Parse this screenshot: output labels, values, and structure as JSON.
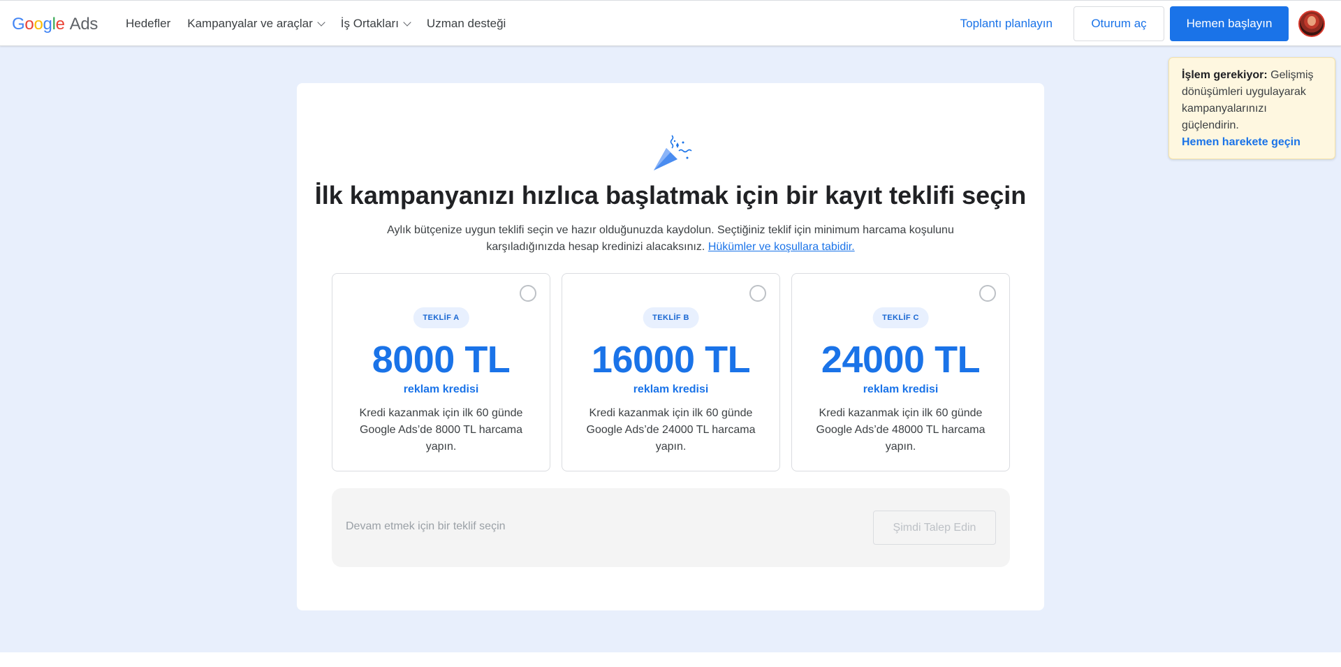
{
  "header": {
    "logo_google": [
      "G",
      "o",
      "o",
      "g",
      "l",
      "e"
    ],
    "logo_ads": "Ads",
    "nav": [
      {
        "label": "Hedefler",
        "dropdown": false
      },
      {
        "label": "Kampanyalar ve araçlar",
        "dropdown": true
      },
      {
        "label": "İş Ortakları",
        "dropdown": true
      },
      {
        "label": "Uzman desteği",
        "dropdown": false
      }
    ],
    "meeting_link": "Toplantı planlayın",
    "sign_in": "Oturum aç",
    "get_started": "Hemen başlayın"
  },
  "notice": {
    "bold": "İşlem gerekiyor:",
    "text": " Gelişmiş dönüşümleri uygulayarak kampanyalarınızı güçlendirin.",
    "action": "Hemen harekete geçin"
  },
  "main": {
    "title": "İlk kampanyanızı hızlıca başlatmak için bir kayıt teklifi seçin",
    "subtitle": "Aylık bütçenize uygun teklifi seçin ve hazır olduğunuzda kaydolun. Seçtiğiniz teklif için minimum harcama koşulunu karşıladığınızda hesap kredinizi alacaksınız. ",
    "terms_link": "Hükümler ve koşullara tabidir.",
    "offers": [
      {
        "badge": "TEKLİF A",
        "amount": "8000 TL",
        "credit": "reklam kredisi",
        "desc": "Kredi kazanmak için ilk 60 günde Google Ads’de 8000 TL harcama yapın."
      },
      {
        "badge": "TEKLİF B",
        "amount": "16000 TL",
        "credit": "reklam kredisi",
        "desc": "Kredi kazanmak için ilk 60 günde Google Ads’de 24000 TL harcama yapın."
      },
      {
        "badge": "TEKLİF C",
        "amount": "24000 TL",
        "credit": "reklam kredisi",
        "desc": "Kredi kazanmak için ilk 60 günde Google Ads’de 48000 TL harcama yapın."
      }
    ],
    "footer_text": "Devam etmek için bir teklif seçin",
    "claim_button": "Şimdi Talep Edin"
  },
  "colors": {
    "accent": "#1a73e8",
    "page_bg": "#e8effc",
    "notice_bg": "#fef7e0"
  },
  "icons": [
    "chevron-down-icon",
    "party-popper-icon",
    "radio-icon",
    "avatar"
  ]
}
